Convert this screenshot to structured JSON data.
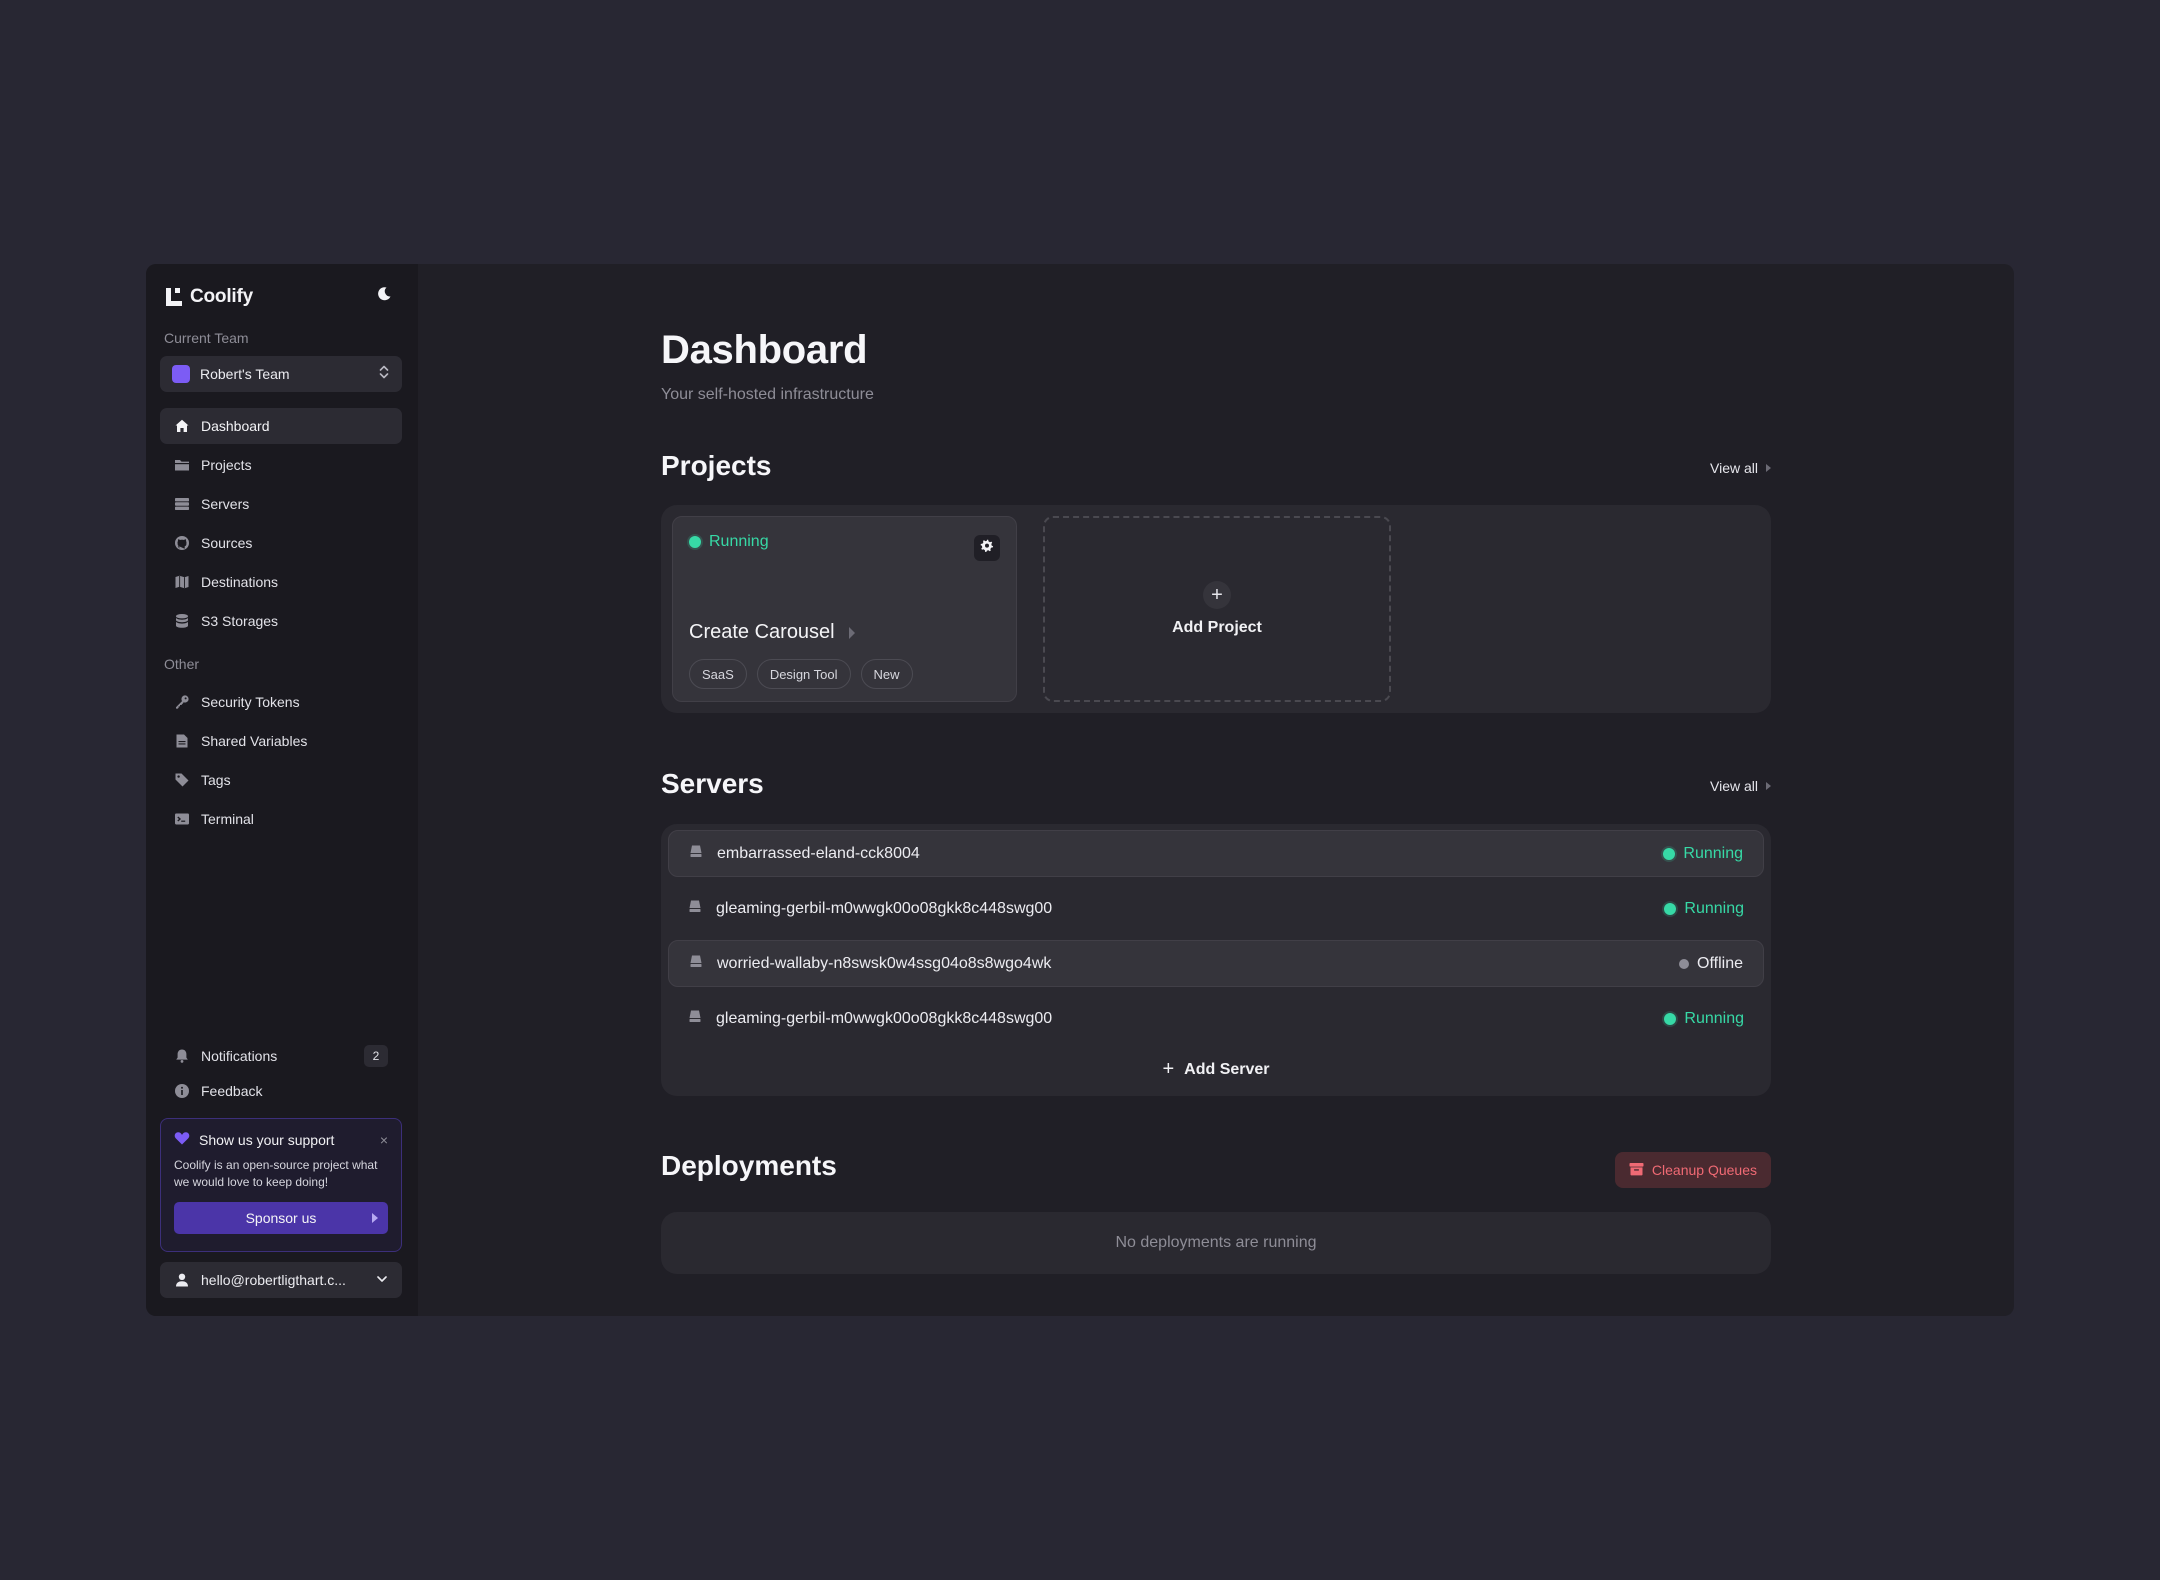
{
  "app": {
    "name": "Coolify"
  },
  "sidebar": {
    "current_team_label": "Current Team",
    "team_name": "Robert's Team",
    "team_color": "#7c5cf5",
    "main_items": [
      {
        "label": "Dashboard",
        "icon": "home-icon",
        "active": true
      },
      {
        "label": "Projects",
        "icon": "folder-icon"
      },
      {
        "label": "Servers",
        "icon": "server-icon"
      },
      {
        "label": "Sources",
        "icon": "github-icon"
      },
      {
        "label": "Destinations",
        "icon": "map-icon"
      },
      {
        "label": "S3 Storages",
        "icon": "database-icon"
      }
    ],
    "other_label": "Other",
    "other_items": [
      {
        "label": "Security Tokens",
        "icon": "key-icon"
      },
      {
        "label": "Shared Variables",
        "icon": "file-icon"
      },
      {
        "label": "Tags",
        "icon": "tag-icon"
      },
      {
        "label": "Terminal",
        "icon": "terminal-icon"
      }
    ],
    "notifications": {
      "label": "Notifications",
      "count": "2"
    },
    "feedback": {
      "label": "Feedback"
    },
    "support": {
      "title": "Show us your support",
      "close": "×",
      "text": "Coolify is an open-source project what we would love to keep doing!",
      "button": "Sponsor us"
    },
    "user_email": "hello@robertligthart.c..."
  },
  "main": {
    "title": "Dashboard",
    "subtitle": "Your self-hosted infrastructure",
    "projects": {
      "title": "Projects",
      "view_all": "View all",
      "items": [
        {
          "status": "Running",
          "name": "Create Carousel",
          "tags": [
            "SaaS",
            "Design Tool",
            "New"
          ]
        }
      ],
      "add_label": "Add Project",
      "add_symbol": "+"
    },
    "servers": {
      "title": "Servers",
      "view_all": "View all",
      "items": [
        {
          "name": "embarrassed-eland-cck8004",
          "status": "Running"
        },
        {
          "name": "gleaming-gerbil-m0wwgk00o08gkk8c448swg00",
          "status": "Running"
        },
        {
          "name": "worried-wallaby-n8swsk0w4ssg04o8s8wgo4wk",
          "status": "Offline"
        },
        {
          "name": "gleaming-gerbil-m0wwgk00o08gkk8c448swg00",
          "status": "Running"
        }
      ],
      "add_label": "Add Server",
      "add_symbol": "+"
    },
    "deployments": {
      "title": "Deployments",
      "cleanup_label": "Cleanup Queues",
      "empty_text": "No deployments are running"
    }
  },
  "colors": {
    "accent": "#7c5cf5",
    "running": "#37d9a6",
    "offline": "#8e8d97",
    "danger": "#f06a74"
  }
}
